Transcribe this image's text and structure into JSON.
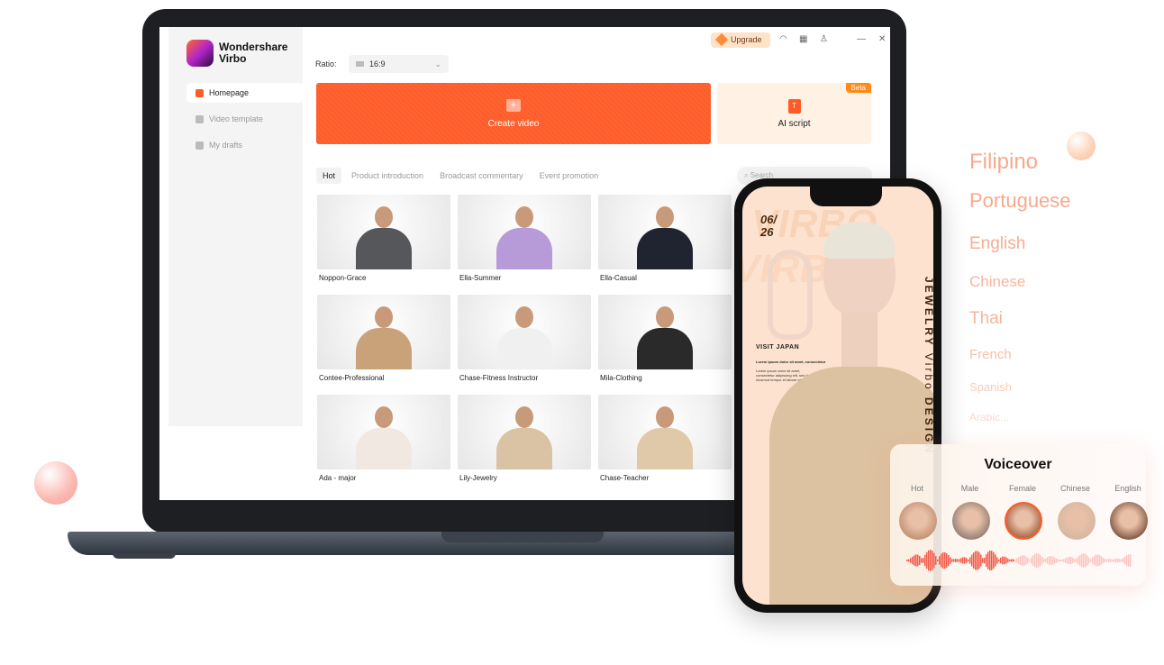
{
  "app": {
    "brand_line1": "Wondershare",
    "brand_line2": "Virbo"
  },
  "sidebar": {
    "items": [
      {
        "label": "Homepage",
        "active": true
      },
      {
        "label": "Video template"
      },
      {
        "label": "My drafts"
      }
    ]
  },
  "topbar": {
    "upgrade": "Upgrade",
    "icons": [
      "headset-icon",
      "grid-icon",
      "user-icon",
      "minimize-icon",
      "close-icon"
    ]
  },
  "ratio": {
    "label": "Ratio:",
    "value": "16:9"
  },
  "actions": {
    "create_video": "Create video",
    "ai_script": "AI script",
    "beta": "Beta"
  },
  "tabs": [
    "Hot",
    "Product introduction",
    "Broadcast commentary",
    "Event promotion"
  ],
  "search": {
    "placeholder": "Search"
  },
  "avatars": [
    {
      "name": "Noppon-Grace",
      "color": "#55575a"
    },
    {
      "name": "Ella-Summer",
      "color": "#b79ad8"
    },
    {
      "name": "Ella-Casual",
      "color": "#1f2430"
    },
    {
      "name": "Contee-Professional",
      "color": "#c9a27a"
    },
    {
      "name": "Chase-Fitness Instructor",
      "color": "#f0f0f0"
    },
    {
      "name": "Mila-Clothing",
      "color": "#2a2a2a"
    },
    {
      "name": "Ada - major",
      "color": "#f2e8e2"
    },
    {
      "name": "Lily-Jewelry",
      "color": "#d9c3a4"
    },
    {
      "name": "Chase-Teacher",
      "color": "#e0c9a8"
    }
  ],
  "phone": {
    "date_line1": "06/",
    "date_line2": "26",
    "visit": "VISIT JAPAN",
    "lorem_title": "Lorem ipsum dolor sit amet, consectetur",
    "lorem_body": "Lorem ipsum dolor sit amet, consectetur adipiscing elit, sed do eiusmod tempor et labore et",
    "vertical_1": "JEWELRY",
    "vertical_2": "Virbo",
    "vertical_3": "DESIGN",
    "watermark": "VIRBO"
  },
  "languages": [
    "Filipino",
    "Portuguese",
    "English",
    "Chinese",
    "Thai",
    "French",
    "Spanish",
    "Arabic..."
  ],
  "voiceover": {
    "title": "Voiceover",
    "tabs": [
      "Hot",
      "Male",
      "Female",
      "Chinese",
      "English"
    ],
    "selected": "Female"
  },
  "colors": {
    "accent": "#ff5b28",
    "language_text": "#f7a98d"
  }
}
